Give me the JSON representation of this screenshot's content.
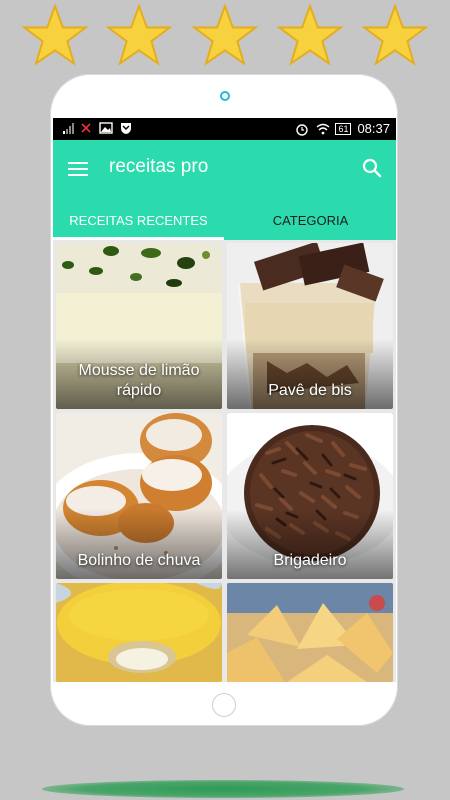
{
  "rating": {
    "stars": 5
  },
  "status_bar": {
    "time": "08:37",
    "battery": "61"
  },
  "app_bar": {
    "title": "receitas pro"
  },
  "tabs": [
    {
      "label": "RECEITAS RECENTES",
      "selected": true
    },
    {
      "label": "CATEGORIA",
      "selected": false
    }
  ],
  "recipes": [
    {
      "name": "Mousse de limão rápido"
    },
    {
      "name": "Pavê de bis"
    },
    {
      "name": "Bolinho de chuva"
    },
    {
      "name": "Brigadeiro"
    },
    {
      "name": ""
    },
    {
      "name": ""
    }
  ],
  "colors": {
    "accent": "#2bdbad",
    "star": "#f7d13e",
    "status_bar": "#000000"
  },
  "icons": [
    "star-icon",
    "menu-icon",
    "search-icon",
    "wifi-icon",
    "alarm-icon",
    "battery-icon",
    "image-icon",
    "shield-icon",
    "signal-icon"
  ]
}
